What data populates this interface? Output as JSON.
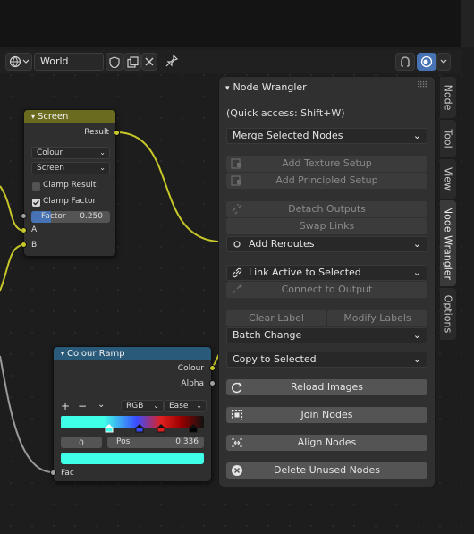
{
  "header": {
    "world_label": "World"
  },
  "screen_node": {
    "title": "Screen",
    "output_result": "Result",
    "colour_select": "Colour",
    "blend_select": "Screen",
    "clamp_result_label": "Clamp Result",
    "clamp_result_checked": false,
    "clamp_factor_label": "Clamp Factor",
    "clamp_factor_checked": true,
    "factor_label": "Factor",
    "factor_value": "0.250",
    "factor_fraction": 0.25,
    "input_a": "A",
    "input_b": "B"
  },
  "colour_ramp_node": {
    "title": "Colour Ramp",
    "output_colour": "Colour",
    "output_alpha": "Alpha",
    "plus": "+",
    "minus": "−",
    "mode_select": "RGB",
    "interp_select": "Ease",
    "index_value": "0",
    "pos_label": "Pos",
    "pos_value": "0.336",
    "input_fac": "Fac"
  },
  "node_wrangler": {
    "title": "Node Wrangler",
    "quick_access": "(Quick access: Shift+W)",
    "merge_menu": "Merge Selected Nodes",
    "add_texture_setup": "Add Texture Setup",
    "add_principled_setup": "Add Principled Setup",
    "detach_outputs": "Detach Outputs",
    "swap_links": "Swap Links",
    "add_reroutes": "Add Reroutes",
    "link_active": "Link Active to Selected",
    "connect_output": "Connect to Output",
    "clear_label": "Clear Label",
    "modify_labels": "Modify Labels",
    "batch_change": "Batch Change",
    "copy_selected": "Copy to Selected",
    "reload_images": "Reload Images",
    "join_nodes": "Join Nodes",
    "align_nodes": "Align Nodes",
    "delete_unused": "Delete Unused Nodes"
  },
  "sidebar_tabs": [
    "Node",
    "Tool",
    "View",
    "Node Wrangler",
    "Options"
  ],
  "colors": {
    "screen_header": "#6b6b20",
    "ramp_header": "#2a5a7a",
    "link_yellow": "#c7c729",
    "link_grey": "#9a9a9a",
    "accent_blue": "#4772b3"
  }
}
